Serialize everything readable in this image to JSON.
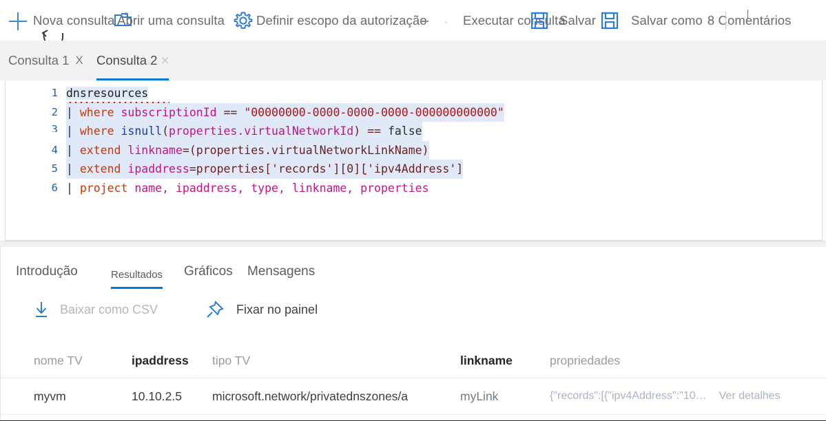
{
  "toolbar": {
    "new_query": "Nova consulta",
    "open_query": "Abrir uma consulta",
    "scope": "Definir escopo da autorização",
    "run_query": "Executar consulta",
    "save": "Salvar",
    "save_as": "Salvar como",
    "comments": "8 Comentários",
    "icons": {
      "plus": "plus-icon",
      "folder_open": "folder-open-icon",
      "gear": "gear-icon",
      "save_1": "floppy-disk-icon",
      "save_2": "floppy-disk-icon"
    }
  },
  "query_tabs": [
    {
      "label": "Consulta 1",
      "close": "X",
      "active": false
    },
    {
      "label": "Consulta 2",
      "close": "⨯",
      "active": true
    }
  ],
  "editor": {
    "lines": [
      "1",
      "2",
      "3",
      "4",
      "5",
      "6"
    ],
    "code": {
      "l1_table": "dnsresources",
      "l2_kw": "where",
      "l2_ident": "subscriptionId",
      "l2_op": "==",
      "l2_str": "\"00000000-0000-0000-0000-000000000000\"",
      "l3_kw": "where",
      "l3_func": "isnull",
      "l3_arg": "properties.virtualNetworkId",
      "l3_op": "==",
      "l3_val": "false",
      "l4_kw": "extend",
      "l4_ident": "linkname",
      "l4_rest": "=(properties.virtualNetworkLinkName)",
      "l5_kw": "extend",
      "l5_ident": "ipaddress",
      "l5_rest": "=properties['records'][0]['ipv4Address']",
      "l6_kw": "project",
      "l6_rest": "name, ipaddress, type, linkname, properties"
    }
  },
  "result_tabs": {
    "introducao": "Introdução",
    "resultados": "Resultados",
    "graficos": "Gráficos",
    "mensagens": "Mensagens"
  },
  "result_actions": {
    "download_csv": "Baixar como CSV",
    "pin_panel": "Fixar no painel",
    "icons": {
      "download": "download-icon",
      "pin": "pin-icon"
    }
  },
  "table": {
    "headers": [
      {
        "label": "nome TV",
        "bold": false
      },
      {
        "label": "ipaddress",
        "bold": true
      },
      {
        "label": "tipo TV",
        "bold": false
      },
      {
        "label": "linkname",
        "bold": true
      },
      {
        "label": "propriedades",
        "bold": false
      }
    ],
    "rows": [
      {
        "nome": "myvm",
        "ipaddress": "10.10.2.5",
        "tipo": "microsoft.network/privatednszones/a",
        "linkname": "myLink",
        "propriedades": "{\"records\":[{\"ipv4Address\":\"10…",
        "details_link": "Ver detalhes"
      }
    ]
  },
  "colors": {
    "accent": "#0078d4",
    "icon_blue": "#3a8ada",
    "line_number": "#1763b0",
    "keyword": "#d13400",
    "identifier": "#c4128a",
    "function": "#1a34c8",
    "string": "#b01515",
    "tab_bg": "#f2f2f2"
  }
}
